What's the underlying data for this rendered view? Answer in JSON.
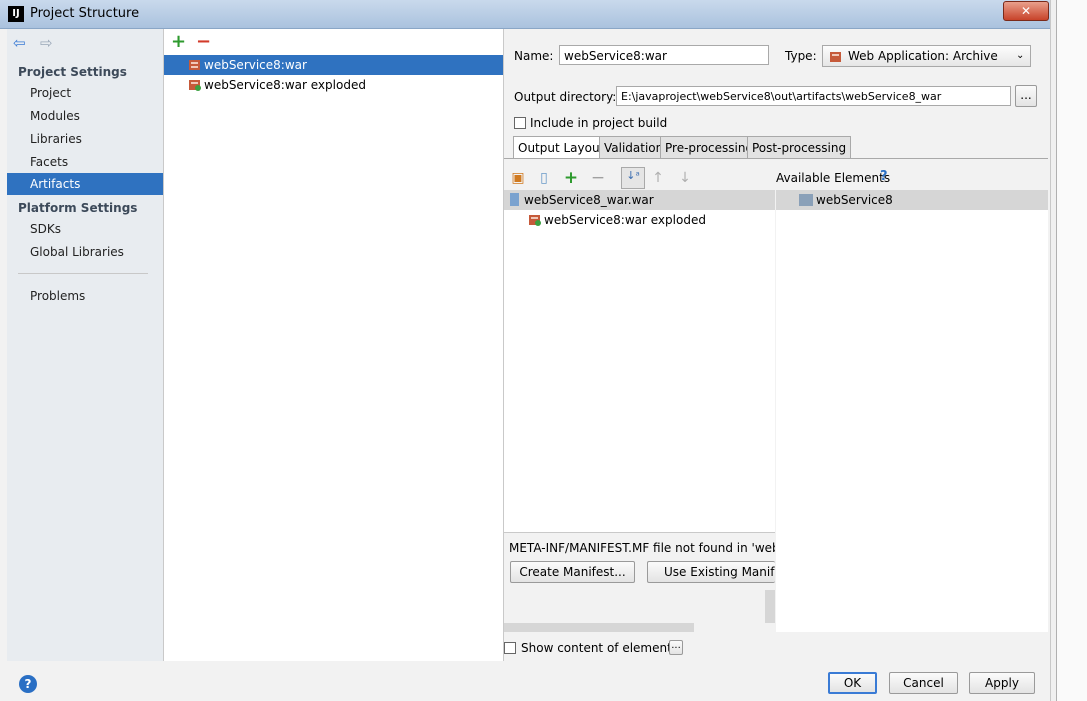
{
  "window": {
    "title": "Project Structure",
    "close": "✕",
    "app_icon": "IJ"
  },
  "nav": {
    "back_icon": "⇦",
    "forward_icon": "⇨",
    "project_settings_header": "Project Settings",
    "project_items": [
      "Project",
      "Modules",
      "Libraries",
      "Facets",
      "Artifacts"
    ],
    "platform_settings_header": "Platform Settings",
    "platform_items": [
      "SDKs",
      "Global Libraries"
    ],
    "problems": "Problems",
    "selected": "Artifacts"
  },
  "artifacts": {
    "add_icon": "+",
    "remove_icon": "−",
    "items": [
      "webService8:war",
      "webService8:war exploded"
    ]
  },
  "detail": {
    "name_label": "Name:",
    "name_value": "webService8:war",
    "type_label": "Type:",
    "type_value": "Web Application: Archive",
    "output_dir_label": "Output directory:",
    "output_dir_value": "E:\\javaproject\\webService8\\out\\artifacts\\webService8_war",
    "browse": "...",
    "include_build": "Include in project build",
    "tabs": [
      "Output Layout",
      "Validation",
      "Pre-processing",
      "Post-processing"
    ],
    "available_elements": "Available Elements",
    "help_q": "?",
    "layout_tree": [
      "webService8_war.war",
      "webService8:war exploded"
    ],
    "available_tree": [
      "webService8"
    ],
    "manifest_msg": "META-INF/MANIFEST.MF file not found in 'webSer",
    "create_manifest": "Create Manifest...",
    "use_existing_manifest": "Use Existing Manifest",
    "show_content": "Show content of elements",
    "show_content_btn": "..."
  },
  "footer": {
    "help": "?",
    "ok": "OK",
    "cancel": "Cancel",
    "apply": "Apply"
  },
  "colors": {
    "selection": "#2f72c0",
    "add_green": "#2e9a2e",
    "remove_red": "#d23a2a"
  }
}
